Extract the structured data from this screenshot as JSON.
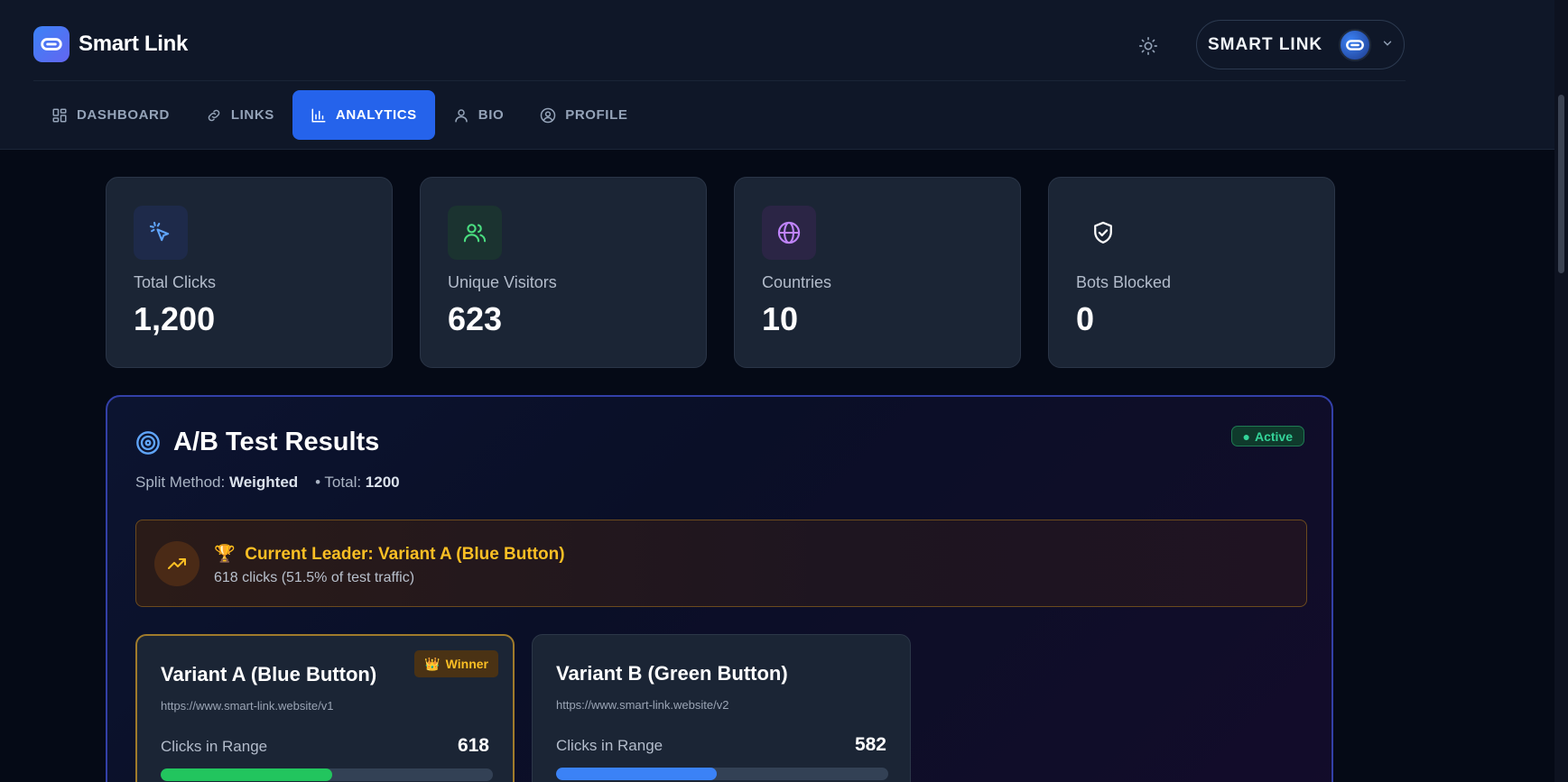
{
  "brand": {
    "name": "Smart Link"
  },
  "user": {
    "name": "SMART LINK"
  },
  "nav": [
    {
      "label": "DASHBOARD",
      "icon": "grid-icon"
    },
    {
      "label": "LINKS",
      "icon": "link-icon"
    },
    {
      "label": "ANALYTICS",
      "icon": "bar-chart-icon",
      "active": true
    },
    {
      "label": "BIO",
      "icon": "user-icon"
    },
    {
      "label": "PROFILE",
      "icon": "user-circle-icon"
    }
  ],
  "stats": [
    {
      "label": "Total Clicks",
      "value": "1,200",
      "icon": "cursor-click-icon",
      "color": "#60a5fa"
    },
    {
      "label": "Unique Visitors",
      "value": "623",
      "icon": "users-icon",
      "color": "#4ade80"
    },
    {
      "label": "Countries",
      "value": "10",
      "icon": "globe-icon",
      "color": "#c084fc"
    },
    {
      "label": "Bots Blocked",
      "value": "0",
      "icon": "shield-check-icon",
      "color": "#ffffff"
    }
  ],
  "ab_test": {
    "title": "A/B Test Results",
    "status": "Active",
    "split_label": "Split Method:",
    "split_value": "Weighted",
    "total_label": "• Total:",
    "total_value": "1200",
    "leader_title": "Current Leader: Variant A (Blue Button)",
    "leader_sub": "618 clicks (51.5% of test traffic)",
    "variants": [
      {
        "title": "Variant A (Blue Button)",
        "url": "https://www.smart-link.website/v1",
        "clicks_label": "Clicks in Range",
        "clicks": "618",
        "share": 0.515,
        "bar_color": "#22c55e",
        "badge": "Winner"
      },
      {
        "title": "Variant B (Green Button)",
        "url": "https://www.smart-link.website/v2",
        "clicks_label": "Clicks in Range",
        "clicks": "582",
        "share": 0.485,
        "bar_color": "#3b82f6"
      }
    ]
  },
  "colors": {
    "accent": "#2563eb",
    "success": "#34d399",
    "warning": "#fbbf24"
  }
}
